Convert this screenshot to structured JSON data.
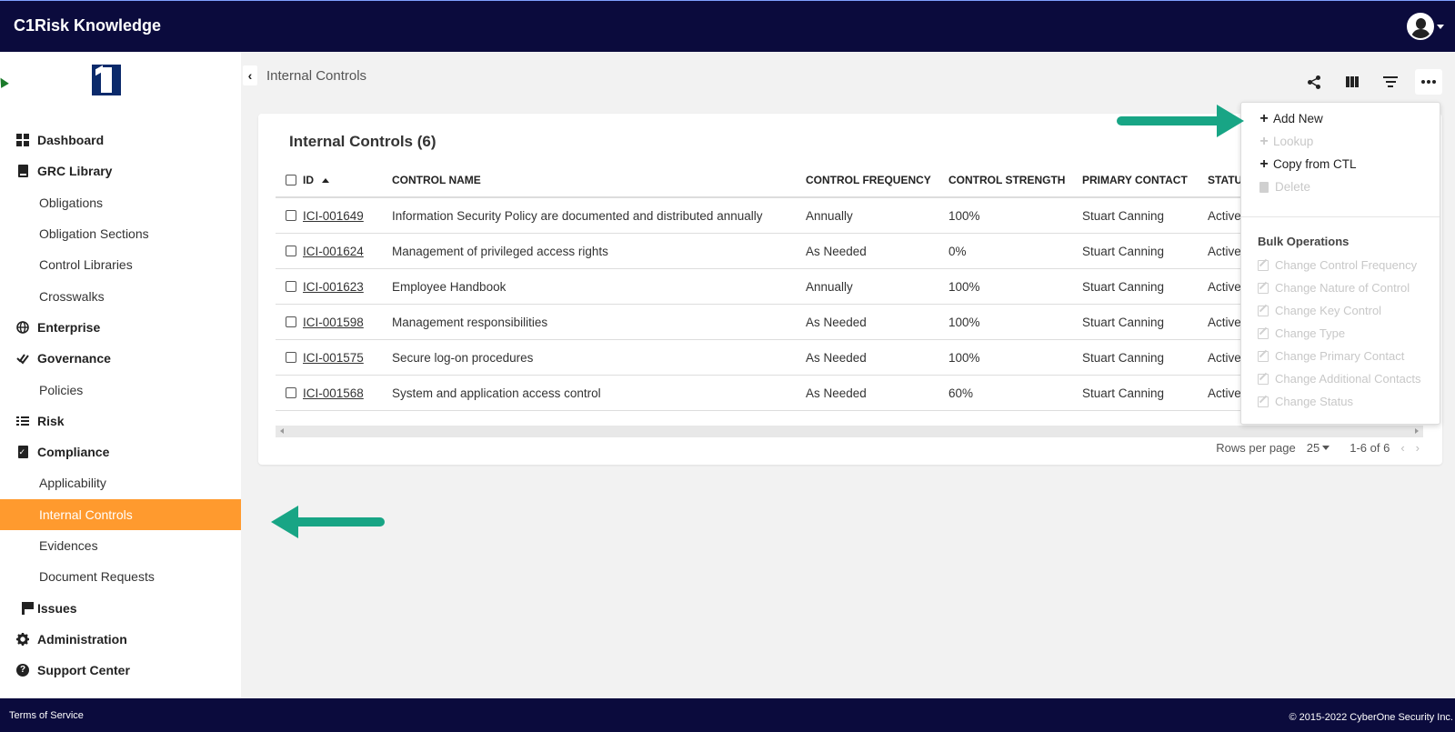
{
  "app": {
    "title": "C1Risk Knowledge"
  },
  "sidebar": {
    "items": [
      {
        "label": "Dashboard",
        "level": "top",
        "icon": "dashboard-icon"
      },
      {
        "label": "GRC Library",
        "level": "top",
        "icon": "book-icon"
      },
      {
        "label": "Obligations",
        "level": "sub"
      },
      {
        "label": "Obligation Sections",
        "level": "sub"
      },
      {
        "label": "Control Libraries",
        "level": "sub"
      },
      {
        "label": "Crosswalks",
        "level": "sub"
      },
      {
        "label": "Enterprise",
        "level": "top",
        "icon": "globe-icon"
      },
      {
        "label": "Governance",
        "level": "top",
        "icon": "double-check-icon"
      },
      {
        "label": "Policies",
        "level": "sub"
      },
      {
        "label": "Risk",
        "level": "top",
        "icon": "list-icon"
      },
      {
        "label": "Compliance",
        "level": "top",
        "icon": "clipboard-check-icon"
      },
      {
        "label": "Applicability",
        "level": "sub"
      },
      {
        "label": "Internal Controls",
        "level": "sub",
        "active": true
      },
      {
        "label": "Evidences",
        "level": "sub"
      },
      {
        "label": "Document Requests",
        "level": "sub"
      },
      {
        "label": "Issues",
        "level": "top",
        "icon": "flag-icon"
      },
      {
        "label": "Administration",
        "level": "top",
        "icon": "gear-icon"
      },
      {
        "label": "Support Center",
        "level": "top",
        "icon": "help-circle-icon"
      }
    ]
  },
  "breadcrumb": {
    "current": "Internal Controls"
  },
  "toolbar": {
    "icons": [
      "share-icon",
      "columns-icon",
      "filter-icon",
      "more-icon"
    ]
  },
  "card": {
    "title": "Internal Controls (6)",
    "columns": [
      "ID",
      "CONTROL NAME",
      "CONTROL FREQUENCY",
      "CONTROL STRENGTH",
      "PRIMARY CONTACT",
      "STATU"
    ],
    "rows": [
      {
        "id": "ICI-001649",
        "name": "Information Security Policy are documented and distributed annually",
        "frequency": "Annually",
        "strength": "100%",
        "contact": "Stuart Canning",
        "status": "Active"
      },
      {
        "id": "ICI-001624",
        "name": "Management of privileged access rights",
        "frequency": "As Needed",
        "strength": "0%",
        "contact": "Stuart Canning",
        "status": "Active"
      },
      {
        "id": "ICI-001623",
        "name": "Employee Handbook",
        "frequency": "Annually",
        "strength": "100%",
        "contact": "Stuart Canning",
        "status": "Active"
      },
      {
        "id": "ICI-001598",
        "name": "Management responsibilities",
        "frequency": "As Needed",
        "strength": "100%",
        "contact": "Stuart Canning",
        "status": "Active"
      },
      {
        "id": "ICI-001575",
        "name": "Secure log-on procedures",
        "frequency": "As Needed",
        "strength": "100%",
        "contact": "Stuart Canning",
        "status": "Active"
      },
      {
        "id": "ICI-001568",
        "name": "System and application access control",
        "frequency": "As Needed",
        "strength": "60%",
        "contact": "Stuart Canning",
        "status": "Active"
      }
    ],
    "pager": {
      "rows_per_page_label": "Rows per page",
      "rows_per_page": "25",
      "range": "1-6 of 6"
    }
  },
  "menu": {
    "actions": [
      {
        "label": "Add New",
        "enabled": true
      },
      {
        "label": "Lookup",
        "enabled": false
      },
      {
        "label": "Copy from CTL",
        "enabled": true
      },
      {
        "label": "Delete",
        "enabled": false
      }
    ],
    "bulk_heading": "Bulk Operations",
    "bulk": [
      "Change Control Frequency",
      "Change Nature of Control",
      "Change Key Control",
      "Change Type",
      "Change Primary Contact",
      "Change Additional Contacts",
      "Change Status"
    ]
  },
  "footer": {
    "terms": "Terms of Service",
    "copyright": "© 2015-2022 CyberOne Security Inc."
  },
  "colors": {
    "topbar": "#0b0b3d",
    "active_nav": "#ff9a2e",
    "arrow": "#18a585"
  }
}
